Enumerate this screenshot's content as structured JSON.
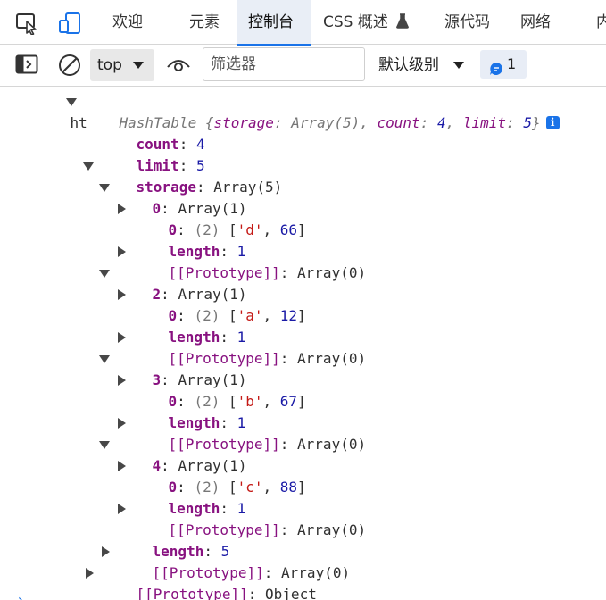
{
  "tabs": [
    {
      "label": "欢迎"
    },
    {
      "label": "元素"
    },
    {
      "label": "控制台"
    },
    {
      "label": "CSS 概述"
    },
    {
      "label": "源代码"
    },
    {
      "label": "网络"
    },
    {
      "label": "内"
    }
  ],
  "toolbar": {
    "context": "top",
    "filter_placeholder": "筛选器",
    "level": "默认级别",
    "message_count": "1"
  },
  "console": {
    "variable": "ht",
    "summary": {
      "class": "HashTable",
      "open": " {",
      "k1": "storage",
      "v1": "Array(5)",
      "k2": "count",
      "v2": "4",
      "k3": "limit",
      "v3": "5",
      "close": "}",
      "sep": ": ",
      "comma": ", "
    },
    "count": {
      "key": "count",
      "value": "4"
    },
    "limit": {
      "key": "limit",
      "value": "5"
    },
    "storage": {
      "key": "storage",
      "value": "Array(5)"
    },
    "buckets": [
      {
        "index": "0",
        "type": "Array(1)",
        "entry_key": "0",
        "entry_len": "(2)",
        "str": "'d'",
        "num": "66",
        "length_key": "length",
        "length": "1",
        "proto": "[[Prototype]]",
        "proto_val": "Array(0)"
      },
      {
        "index": "2",
        "type": "Array(1)",
        "entry_key": "0",
        "entry_len": "(2)",
        "str": "'a'",
        "num": "12",
        "length_key": "length",
        "length": "1",
        "proto": "[[Prototype]]",
        "proto_val": "Array(0)"
      },
      {
        "index": "3",
        "type": "Array(1)",
        "entry_key": "0",
        "entry_len": "(2)",
        "str": "'b'",
        "num": "67",
        "length_key": "length",
        "length": "1",
        "proto": "[[Prototype]]",
        "proto_val": "Array(0)"
      },
      {
        "index": "4",
        "type": "Array(1)",
        "entry_key": "0",
        "entry_len": "(2)",
        "str": "'c'",
        "num": "88",
        "length_key": "length",
        "length": "1",
        "proto": "[[Prototype]]",
        "proto_val": "Array(0)"
      }
    ],
    "storage_length": {
      "key": "length",
      "value": "5"
    },
    "storage_proto": {
      "key": "[[Prototype]]",
      "value": "Array(0)"
    },
    "object_proto": {
      "key": "[[Prototype]]",
      "value": "Object"
    },
    "prompt": "›"
  },
  "colors": {
    "accent": "#1a73e8",
    "key": "#881280",
    "number": "#1a1aa6",
    "string": "#c41a16"
  },
  "icons": [
    "inspect-icon",
    "device-toolbar-icon",
    "flask-icon",
    "sidebar-toggle-icon",
    "clear-console-icon",
    "eye-icon",
    "message-icon",
    "info-icon",
    "expand-triangle-icon",
    "collapse-triangle-icon"
  ]
}
